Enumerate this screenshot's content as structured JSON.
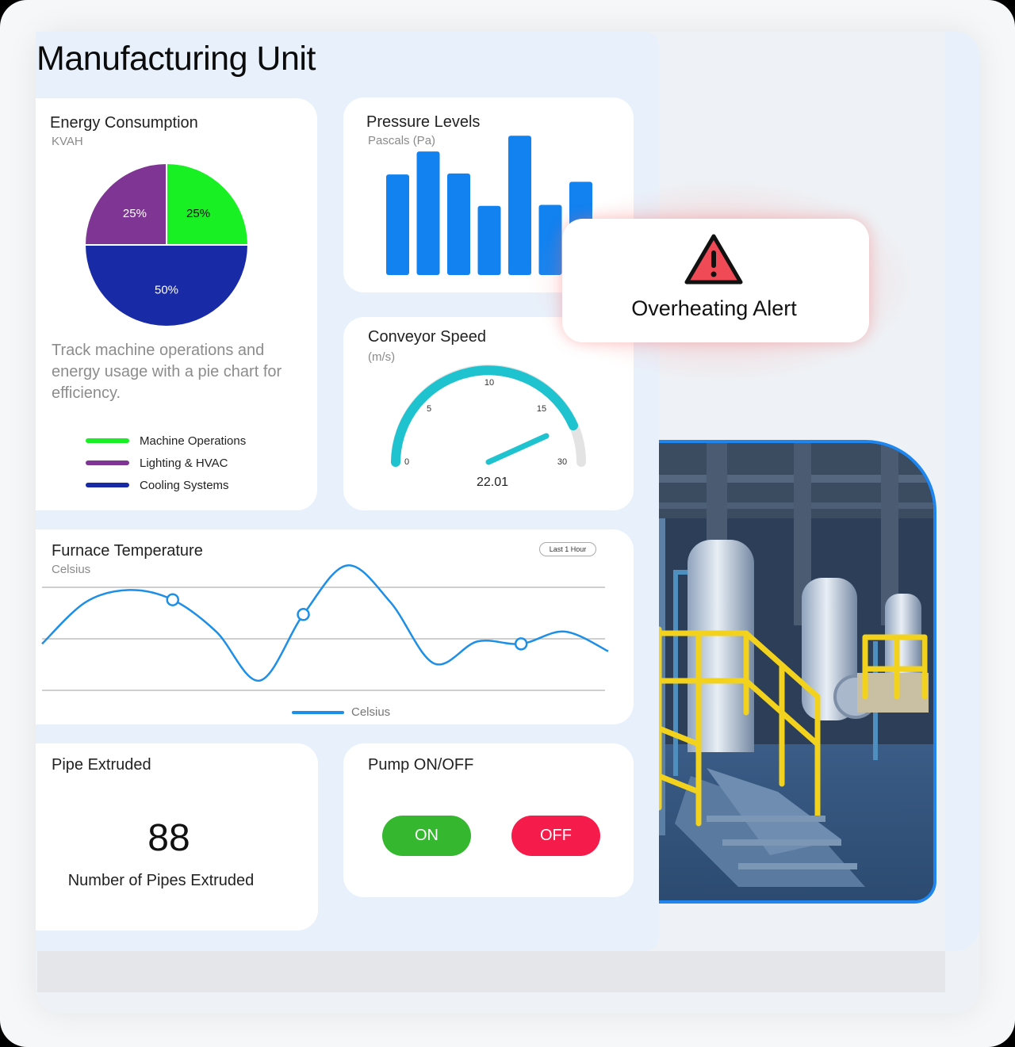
{
  "page": {
    "title": "Manufacturing Unit"
  },
  "energy": {
    "title": "Energy Consumption",
    "unit": "KVAH",
    "description": "Track machine operations and energy usage with a pie chart for efficiency.",
    "slices": [
      {
        "label": "Machine Operations",
        "value": 25,
        "display": "25%",
        "color": "#19f024"
      },
      {
        "label": "Cooling Systems",
        "value": 50,
        "display": "50%",
        "color": "#182aa6"
      },
      {
        "label": "Lighting & HVAC",
        "value": 25,
        "display": "25%",
        "color": "#7f3594"
      }
    ],
    "legend": [
      {
        "label": "Machine Operations",
        "color": "#19f024"
      },
      {
        "label": "Lighting & HVAC",
        "color": "#7f3594"
      },
      {
        "label": "Cooling Systems",
        "color": "#182aa6"
      }
    ]
  },
  "pressure": {
    "title": "Pressure Levels",
    "unit": "Pascals (Pa)",
    "color": "#1282f0"
  },
  "conveyor": {
    "title": "Conveyor Speed",
    "unit": "(m/s)",
    "value": "22.01",
    "arc_color": "#1fc3cf",
    "ticks": [
      "0",
      "5",
      "10",
      "15",
      "30"
    ]
  },
  "furnace": {
    "title": "Furnace Temperature",
    "unit": "Celsius",
    "range": "Last 1 Hour",
    "series_name": "Celsius",
    "line_color": "#1e8fe6"
  },
  "pipe": {
    "title": "Pipe Extruded",
    "value": "88",
    "caption": "Number of Pipes Extruded"
  },
  "pump": {
    "title": "Pump ON/OFF",
    "on_label": "ON",
    "off_label": "OFF",
    "on_color": "#35b82f",
    "off_color": "#f51b4a"
  },
  "alert": {
    "text": "Overheating Alert",
    "icon": "warning-icon",
    "color": "#ef4a55"
  },
  "photo": {
    "subject": "industrial-plant-photo"
  },
  "chart_data": [
    {
      "type": "pie",
      "title": "Energy Consumption",
      "subtitle": "KVAH",
      "categories": [
        "Machine Operations",
        "Lighting & HVAC",
        "Cooling Systems"
      ],
      "values": [
        25,
        25,
        50
      ],
      "legend": "bottom"
    },
    {
      "type": "bar",
      "title": "Pressure Levels",
      "subtitle": "Pascals (Pa)",
      "values": [
        96,
        118,
        97,
        66,
        133,
        67,
        89
      ],
      "ylim": [
        0,
        140
      ],
      "grid": false
    },
    {
      "type": "line",
      "title": "Furnace Temperature",
      "subtitle": "Celsius",
      "series": [
        {
          "name": "Celsius",
          "values": [
            36,
            70,
            80,
            72,
            46,
            6,
            60,
            100,
            70,
            20,
            38,
            36,
            46,
            30
          ]
        }
      ],
      "x": [
        0,
        1,
        2,
        3,
        4,
        5,
        6,
        7,
        8,
        9,
        10,
        11,
        12,
        13
      ],
      "ylim": [
        0,
        110
      ],
      "grid": true,
      "legend": "bottom"
    }
  ]
}
